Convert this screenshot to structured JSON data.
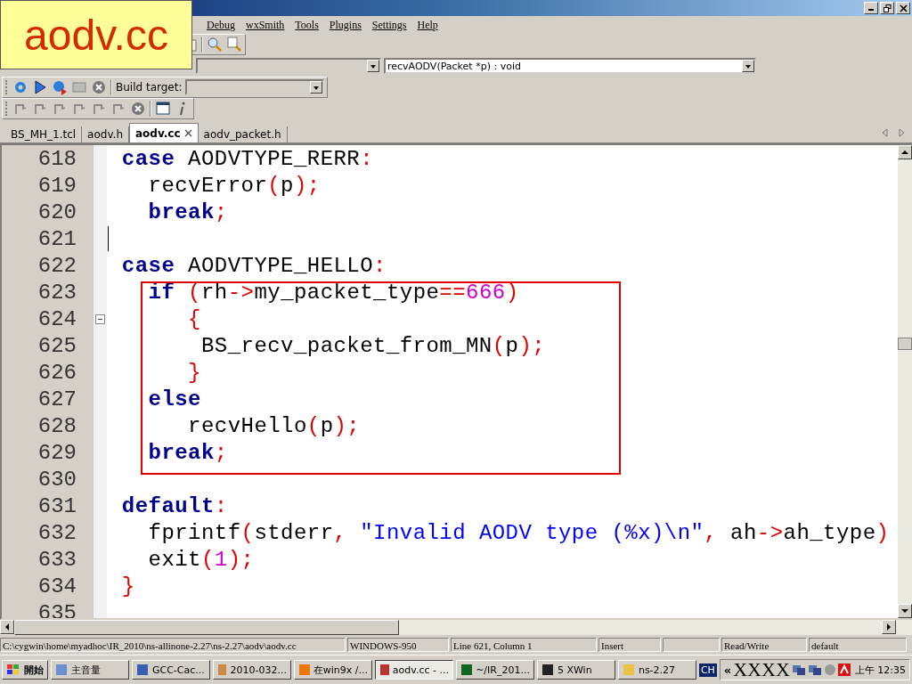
{
  "overlay_label": "aodv.cc",
  "menu": [
    "Debug",
    "wxSmith",
    "Tools",
    "Plugins",
    "Settings",
    "Help"
  ],
  "function_selector": {
    "value": "recvAODV(Packet *p) : void"
  },
  "build_target": {
    "label": "Build target:"
  },
  "tabs": [
    {
      "label": "BS_MH_1.tcl",
      "selected": false,
      "closable": false
    },
    {
      "label": "aodv.h",
      "selected": false,
      "closable": false
    },
    {
      "label": "aodv.cc",
      "selected": true,
      "closable": true
    },
    {
      "label": "aodv_packet.h",
      "selected": false,
      "closable": false
    }
  ],
  "code_lines": [
    {
      "number": "618",
      "fold": false,
      "caret": false,
      "tokens": [
        {
          "keyword": " case"
        },
        {
          "plain": " AODVTYPE_RERR"
        },
        {
          "operator": ":"
        }
      ]
    },
    {
      "number": "619",
      "fold": false,
      "caret": false,
      "tokens": [
        {
          "plain": "   recvError"
        },
        {
          "operator": "("
        },
        {
          "plain": "p"
        },
        {
          "operator": ");"
        }
      ]
    },
    {
      "number": "620",
      "fold": false,
      "caret": false,
      "tokens": [
        {
          "keyword": "   break"
        },
        {
          "operator": ";"
        }
      ]
    },
    {
      "number": "621",
      "fold": false,
      "caret": true
    },
    {
      "number": "622",
      "fold": false,
      "caret": false,
      "tokens": [
        {
          "keyword": " case"
        },
        {
          "plain": " AODVTYPE_HELLO"
        },
        {
          "operator": ":"
        }
      ]
    },
    {
      "number": "623",
      "fold": false,
      "caret": false,
      "tokens": [
        {
          "keyword": "   if"
        },
        {
          "operator": " ("
        },
        {
          "plain": "rh"
        },
        {
          "operator": "->"
        },
        {
          "plain": "my_packet_type"
        },
        {
          "operator": "=="
        },
        {
          "number": "666"
        },
        {
          "operator": ")"
        }
      ]
    },
    {
      "number": "624",
      "fold": true,
      "caret": false,
      "tokens": [
        {
          "operator": "      {"
        }
      ]
    },
    {
      "number": "625",
      "fold": false,
      "caret": false,
      "tokens": [
        {
          "plain": "       BS_recv_packet_from_MN"
        },
        {
          "operator": "("
        },
        {
          "plain": "p"
        },
        {
          "operator": ");"
        }
      ]
    },
    {
      "number": "626",
      "fold": false,
      "caret": false,
      "tokens": [
        {
          "operator": "      }"
        }
      ]
    },
    {
      "number": "627",
      "fold": false,
      "caret": false,
      "tokens": [
        {
          "keyword": "   else"
        }
      ]
    },
    {
      "number": "628",
      "fold": false,
      "caret": false,
      "tokens": [
        {
          "plain": "      recvHello"
        },
        {
          "operator": "("
        },
        {
          "plain": "p"
        },
        {
          "operator": ");"
        }
      ]
    },
    {
      "number": "629",
      "fold": false,
      "caret": false,
      "tokens": [
        {
          "keyword": "   break"
        },
        {
          "operator": ";"
        }
      ]
    },
    {
      "number": "630",
      "fold": false,
      "caret": false
    },
    {
      "number": "631",
      "fold": false,
      "caret": false,
      "tokens": [
        {
          "keyword": " default"
        },
        {
          "operator": ":"
        }
      ]
    },
    {
      "number": "632",
      "fold": false,
      "caret": false,
      "tokens": [
        {
          "plain": "   fprintf"
        },
        {
          "operator": "("
        },
        {
          "plain": "stderr"
        },
        {
          "operator": ", "
        },
        {
          "string": "\"Invalid AODV type (%x)\\n\""
        },
        {
          "operator": ","
        },
        {
          "plain": " ah"
        },
        {
          "operator": "->"
        },
        {
          "plain": "ah_type"
        },
        {
          "operator": ")"
        }
      ]
    },
    {
      "number": "633",
      "fold": false,
      "caret": false,
      "tokens": [
        {
          "plain": "   exit"
        },
        {
          "operator": "("
        },
        {
          "number": "1"
        },
        {
          "operator": ");"
        }
      ]
    },
    {
      "number": "634",
      "fold": false,
      "caret": false,
      "tokens": [
        {
          "operator": " }"
        }
      ]
    },
    {
      "number": "635",
      "fold": false,
      "caret": false
    }
  ],
  "status_bar": [
    "C:\\cygwin\\home\\myadhoc\\IR_2010\\ns-allinone-2.27\\ns-2.27\\aodv\\aodv.cc",
    "WINDOWS-950",
    "Line 621, Column 1",
    "Insert",
    "Read/Write",
    "default"
  ],
  "taskbar": {
    "start": "開始",
    "items": [
      {
        "label": "主音量",
        "selected": false
      },
      {
        "label": "GCC-Cac...",
        "selected": false
      },
      {
        "label": "2010-032...",
        "selected": false
      },
      {
        "label": "在win9x /...",
        "selected": false
      },
      {
        "label": "aodv.cc - ...",
        "selected": true
      },
      {
        "label": "~/IR_201...",
        "selected": false
      },
      {
        "label": "5 XWin",
        "selected": false
      },
      {
        "label": "ns-2.27",
        "selected": false
      }
    ],
    "language": "CH",
    "tray_expand": "«",
    "tray_text": "XXXX",
    "clock": "上午 12:35"
  }
}
